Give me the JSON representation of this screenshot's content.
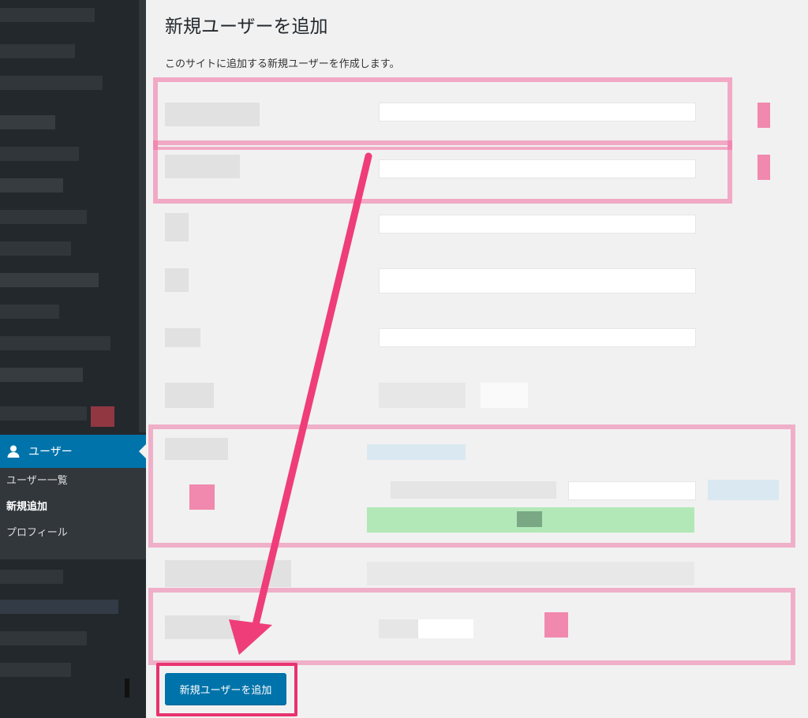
{
  "sidebar": {
    "users_menu": {
      "label": "ユーザー",
      "icon": "user-icon"
    },
    "submenu": [
      {
        "label": "ユーザー一覧"
      },
      {
        "label": "新規追加",
        "current": true
      },
      {
        "label": "プロフィール"
      }
    ]
  },
  "main": {
    "title": "新規ユーザーを追加",
    "description": "このサイトに追加する新規ユーザーを作成します。",
    "submit_label": "新規ユーザーを追加"
  },
  "colors": {
    "accent": "#0073aa",
    "highlight": "#e8336f",
    "sidebar_bg": "#23282d"
  }
}
